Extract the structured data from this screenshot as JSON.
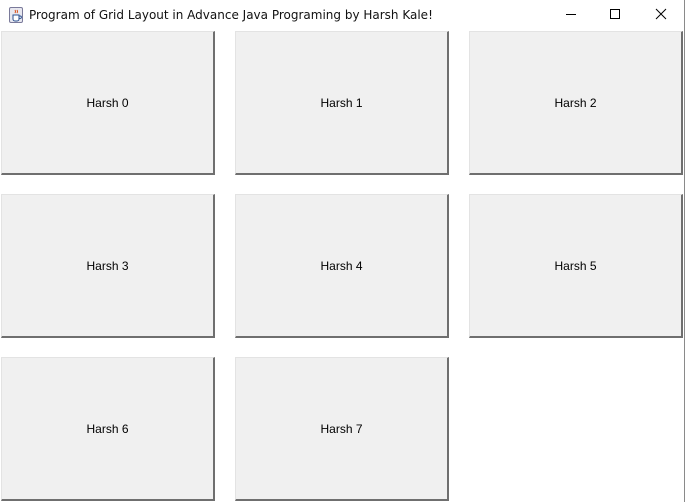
{
  "window": {
    "title": "Program of Grid Layout in Advance Java Programing by Harsh Kale!",
    "icon": "java-coffee-cup-icon",
    "controls": {
      "minimize": "minimize-icon",
      "maximize": "maximize-icon",
      "close": "close-icon"
    }
  },
  "grid": {
    "rows": 3,
    "columns": 3,
    "buttons": [
      {
        "label": "Harsh 0"
      },
      {
        "label": "Harsh 1"
      },
      {
        "label": "Harsh 2"
      },
      {
        "label": "Harsh 3"
      },
      {
        "label": "Harsh 4"
      },
      {
        "label": "Harsh 5"
      },
      {
        "label": "Harsh 6"
      },
      {
        "label": "Harsh 7"
      }
    ]
  }
}
